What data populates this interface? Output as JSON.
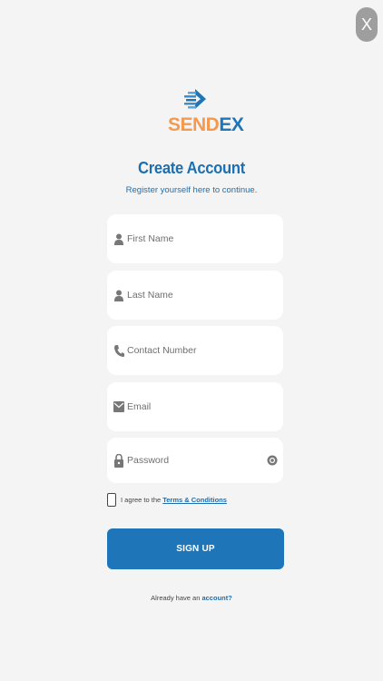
{
  "close_label": "X",
  "brand": {
    "part1": "SEND",
    "part2": "EX",
    "accent_orange": "#f39a50",
    "accent_blue": "#1e76b8"
  },
  "header": {
    "title": "Create Account",
    "subtitle": "Register yourself here to continue."
  },
  "form": {
    "first_name": {
      "placeholder": "First Name",
      "icon": "person-icon"
    },
    "last_name": {
      "placeholder": "Last Name",
      "icon": "person-icon"
    },
    "contact": {
      "placeholder": "Contact Number",
      "icon": "phone-icon"
    },
    "email": {
      "placeholder": "Email",
      "icon": "mail-icon"
    },
    "password": {
      "placeholder": "Password",
      "icon": "lock-icon",
      "toggle_icon": "eye-icon"
    }
  },
  "terms": {
    "prefix": "I agree to the",
    "link": "Terms & Conditions",
    "checked": false
  },
  "signup_label": "SIGN UP",
  "footer": {
    "prefix": "Already have an",
    "link": "account?"
  }
}
